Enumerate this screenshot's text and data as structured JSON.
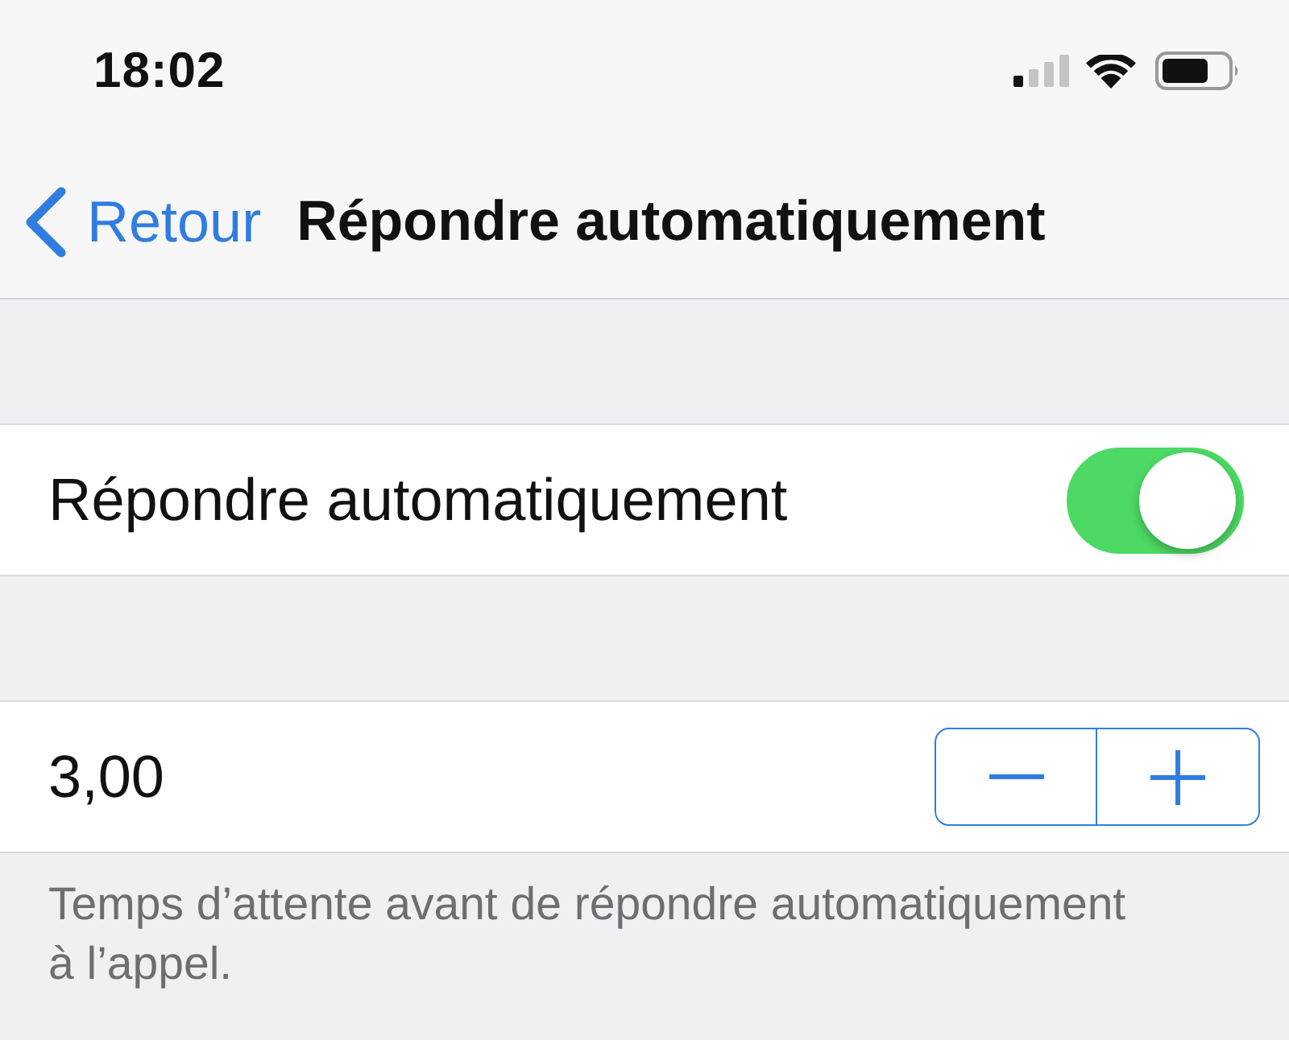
{
  "status_bar": {
    "time": "18:02"
  },
  "nav_bar": {
    "back_label": "Retour",
    "title": "Répondre automatiquement"
  },
  "sections": [
    {
      "rows": [
        {
          "kind": "toggle",
          "label": "Répondre automatiquement",
          "on": true
        }
      ]
    },
    {
      "rows": [
        {
          "kind": "stepper",
          "label": "3,00"
        }
      ],
      "footer": "Temps d’attente avant de répondre automatiquement à l’appel."
    }
  ]
}
